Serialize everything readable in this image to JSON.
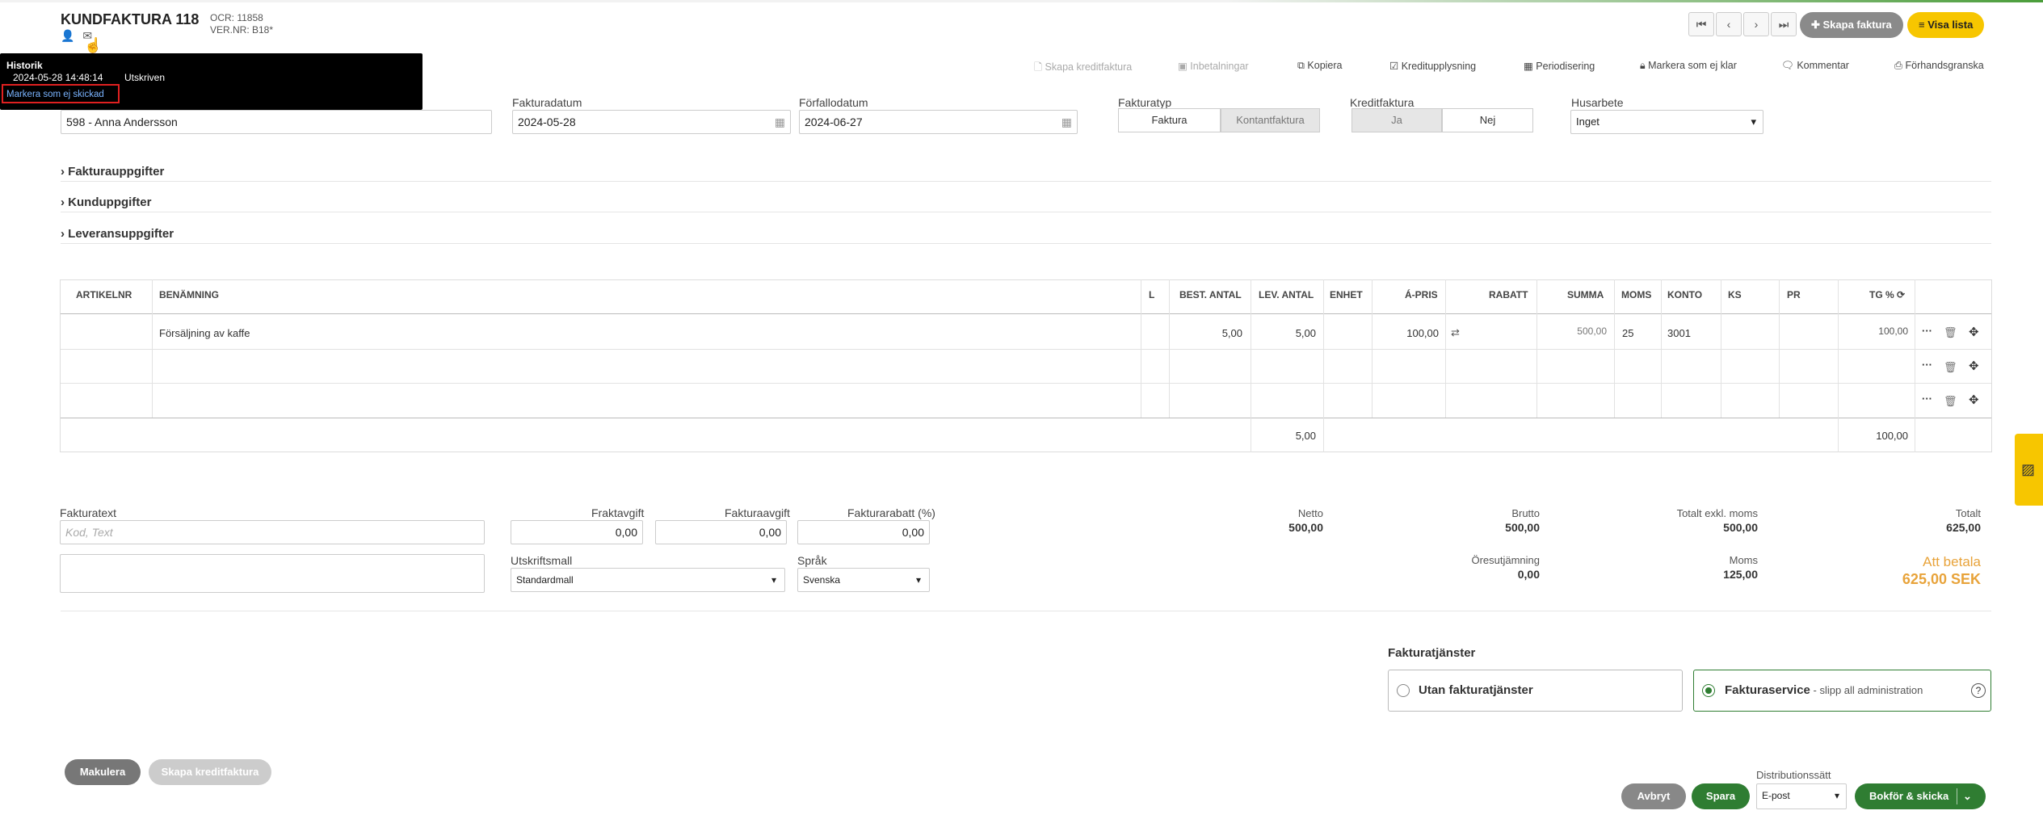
{
  "header": {
    "title": "KUNDFAKTURA 118",
    "ocr": "OCR: 11858",
    "vernr": "VER.NR: B18*",
    "create_invoice": "Skapa faktura",
    "show_list": "Visa lista"
  },
  "tooltip": {
    "title": "Historik",
    "timestamp": "2024-05-28 14:48:14",
    "status": "Utskriven",
    "link": "Markera som ej skickad"
  },
  "toolbar": {
    "create_credit": "Skapa kreditfaktura",
    "payments": "Inbetalningar",
    "copy": "Kopiera",
    "credit_info": "Kreditupplysning",
    "accrual": "Periodisering",
    "mark_not_ready": "Markera som ej klar",
    "comment": "Kommentar",
    "preview": "Förhandsgranska"
  },
  "form": {
    "customer_value": "598 - Anna Andersson",
    "invoice_date_label": "Fakturadatum",
    "invoice_date": "2024-05-28",
    "due_date_label": "Förfallodatum",
    "due_date": "2024-06-27",
    "invoice_type_label": "Fakturatyp",
    "type_invoice": "Faktura",
    "type_cash": "Kontantfaktura",
    "credit_label": "Kreditfaktura",
    "credit_yes": "Ja",
    "credit_no": "Nej",
    "house_label": "Husarbete",
    "house_value": "Inget"
  },
  "sections": {
    "invoice_details": "Fakturauppgifter",
    "customer_details": "Kunduppgifter",
    "delivery_details": "Leveransuppgifter"
  },
  "table": {
    "headers": {
      "artnr": "ARTIKELNR",
      "name": "BENÄMNING",
      "l": "L",
      "best": "BEST. ANTAL",
      "lev": "LEV. ANTAL",
      "unit": "ENHET",
      "price": "Á-PRIS",
      "discount": "RABATT",
      "sum": "SUMMA",
      "vat": "MOMS",
      "account": "KONTO",
      "ks": "KS",
      "pr": "PR",
      "tg": "TG %"
    },
    "row1": {
      "name": "Försäljning av kaffe",
      "best": "5,00",
      "lev": "5,00",
      "price": "100,00",
      "sum": "500,00",
      "vat": "25",
      "account": "3001",
      "tg": "100,00"
    },
    "footer": {
      "lev_total": "5,00",
      "tg_total": "100,00"
    }
  },
  "lower": {
    "invoice_text_label": "Fakturatext",
    "invoice_text_placeholder": "Kod, Text",
    "freight_label": "Fraktavgift",
    "freight_value": "0,00",
    "fee_label": "Fakturaavgift",
    "fee_value": "0,00",
    "discount_label": "Fakturarabatt (%)",
    "discount_value": "0,00",
    "template_label": "Utskriftsmall",
    "template_value": "Standardmall",
    "language_label": "Språk",
    "language_value": "Svenska"
  },
  "totals": {
    "netto_label": "Netto",
    "netto": "500,00",
    "brutto_label": "Brutto",
    "brutto": "500,00",
    "excl_label": "Totalt exkl. moms",
    "excl": "500,00",
    "total_label": "Totalt",
    "total": "625,00",
    "rounding_label": "Öresutjämning",
    "rounding": "0,00",
    "vat_label": "Moms",
    "vat": "125,00",
    "to_pay_label": "Att betala",
    "to_pay": "625,00 SEK"
  },
  "services": {
    "title": "Fakturatjänster",
    "none": "Utan fakturatjänster",
    "service_name": "Fakturaservice",
    "service_desc": " - slipp all administration"
  },
  "bottom": {
    "cancel_invoice": "Makulera",
    "create_credit": "Skapa kreditfaktura",
    "abort": "Avbryt",
    "save": "Spara",
    "dist_label": "Distributionssätt",
    "dist_value": "E-post",
    "book_send": "Bokför & skicka"
  },
  "colors": {
    "accent_green": "#2f7d32",
    "yellow": "#f7c600",
    "orange": "#e8a33a"
  }
}
